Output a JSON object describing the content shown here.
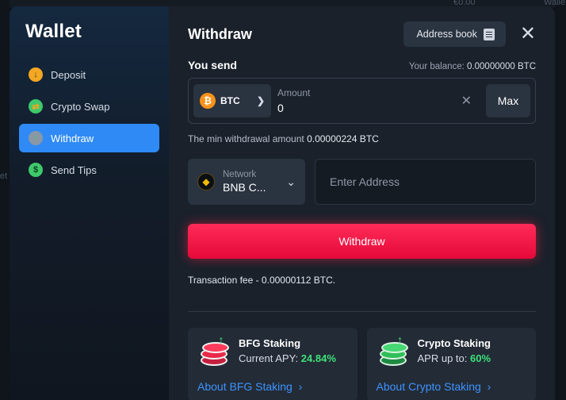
{
  "background": {
    "frag_top": "€0.00",
    "frag_right_top": "Walle",
    "frag_left": "et"
  },
  "sidebar": {
    "title": "Wallet",
    "items": [
      {
        "label": "Deposit",
        "icon": "deposit-icon",
        "color": "#f5a623"
      },
      {
        "label": "Crypto Swap",
        "icon": "swap-icon",
        "color": "#3ec96b"
      },
      {
        "label": "Withdraw",
        "icon": "withdraw-icon",
        "color": "#3ec96b",
        "active": true
      },
      {
        "label": "Send Tips",
        "icon": "tips-icon",
        "color": "#3ec96b"
      }
    ]
  },
  "header": {
    "title": "Withdraw",
    "address_book_label": "Address book",
    "close_glyph": "✕"
  },
  "send": {
    "label": "You send",
    "balance_label": "Your balance:",
    "balance_value": "0.00000000 BTC",
    "coin": "BTC",
    "coin_glyph": "₿",
    "amount_label": "Amount",
    "amount_value": "0",
    "clear_glyph": "✕",
    "max_label": "Max"
  },
  "min_note": {
    "text": "The min withdrawal amount",
    "value": "0.00000224 BTC"
  },
  "network": {
    "label": "Network",
    "value": "BNB C...",
    "address_placeholder": "Enter Address"
  },
  "withdraw_button": "Withdraw",
  "fee": "Transaction fee - 0.00000112 BTC.",
  "staking": [
    {
      "title": "BFG Staking",
      "apy_label": "Current APY:",
      "apy_value": "24.84%",
      "link": "About BFG Staking",
      "chip_color": "#e8294a"
    },
    {
      "title": "Crypto Staking",
      "apy_label": "APR up to:",
      "apy_value": "60%",
      "link": "About Crypto Staking",
      "chip_color": "#2fbf5a"
    }
  ],
  "colors": {
    "accent": "#2f8af5",
    "danger": "#ff1e46",
    "positive": "#3ee07a",
    "link": "#3d93ff"
  }
}
